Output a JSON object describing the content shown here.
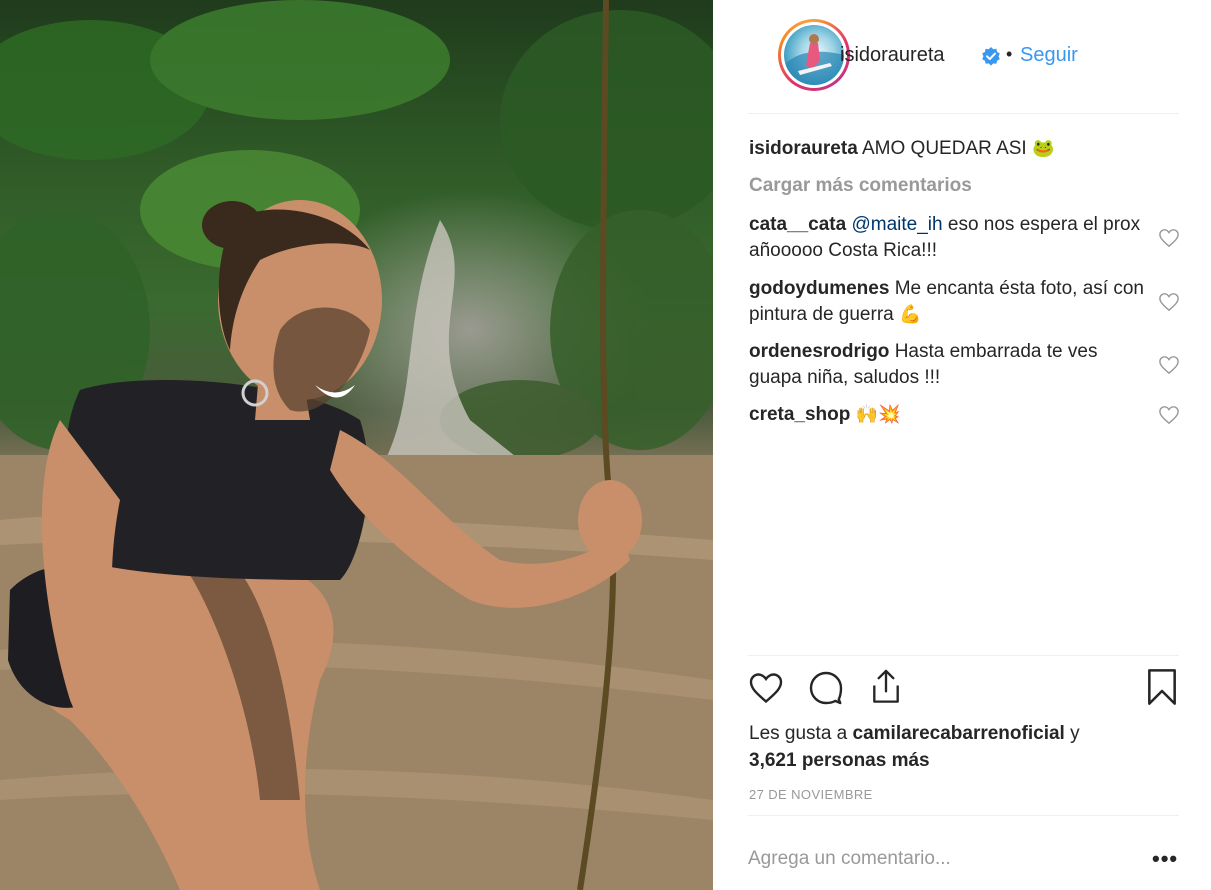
{
  "post": {
    "photo_icon": "post-photo-woman-in-river-with-stick"
  },
  "header": {
    "username": "isidoraureta",
    "verified_icon": "verified-badge-icon",
    "separator": "•",
    "follow_label": "Seguir",
    "avatar_icon": "profile-avatar-surfer"
  },
  "caption": {
    "username": "isidoraureta",
    "text": "AMO QUEDAR ASI",
    "emoji": "🐸"
  },
  "load_more_label": "Cargar más comentarios",
  "comments": [
    {
      "username": "cata__cata",
      "mention": "@maite_ih",
      "text": " eso nos espera el prox añooooo Costa Rica!!!",
      "emoji": ""
    },
    {
      "username": "godoydumenes",
      "mention": "",
      "text": "Me encanta ésta foto, así con pintura de guerra",
      "emoji": "💪"
    },
    {
      "username": "ordenesrodrigo",
      "mention": "",
      "text": "Hasta embarrada te ves guapa niña, saludos !!!",
      "emoji": ""
    },
    {
      "username": "creta_shop",
      "mention": "",
      "text": "",
      "emoji": "🙌💥"
    }
  ],
  "likes": {
    "prefix": "Les gusta a",
    "user": "camilarecabarrenoficial",
    "connector": "y",
    "others": "3,621 personas más"
  },
  "date": "27 DE NOVIEMBRE",
  "add_comment": {
    "placeholder": "Agrega un comentario...",
    "more_label": "•••"
  },
  "colors": {
    "link_blue": "#3897f0",
    "mention_blue": "#003569",
    "muted_gray": "#999999",
    "text": "#262626",
    "divider": "#efefef"
  }
}
